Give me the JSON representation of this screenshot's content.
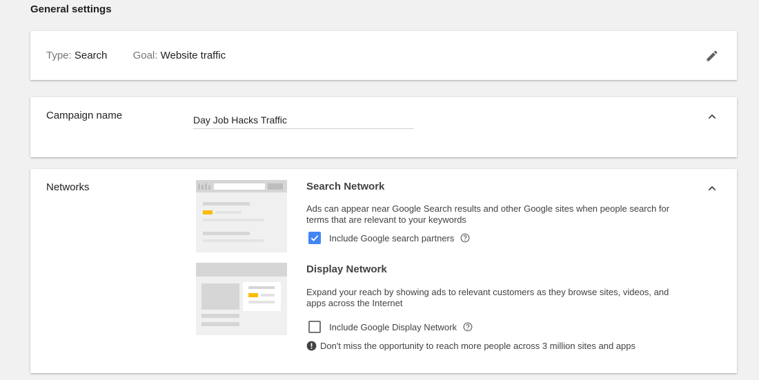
{
  "section_title": "General settings",
  "type_card": {
    "type_label": "Type:",
    "type_value": "Search",
    "goal_label": "Goal:",
    "goal_value": "Website traffic"
  },
  "campaign_name": {
    "label": "Campaign name",
    "value": "Day Job Hacks Traffic"
  },
  "networks": {
    "label": "Networks",
    "search": {
      "title": "Search Network",
      "description": "Ads can appear near Google Search results and other Google sites when people search for terms that are relevant to your keywords",
      "checkbox_label": "Include Google search partners",
      "checked": true
    },
    "display": {
      "title": "Display Network",
      "description": "Expand your reach by showing ads to relevant customers as they browse sites, videos, and apps across the Internet",
      "checkbox_label": "Include Google Display Network",
      "checked": false,
      "warning": "Don't miss the opportunity to reach more people across 3 million sites and apps"
    }
  },
  "icons": [
    "edit-icon",
    "chevron-up-icon",
    "help-icon",
    "warning-icon",
    "checkmark-icon"
  ],
  "colors": {
    "accent_blue": "#4285f4",
    "highlight_yellow": "#fbbc04",
    "background": "#f1f1f1"
  }
}
